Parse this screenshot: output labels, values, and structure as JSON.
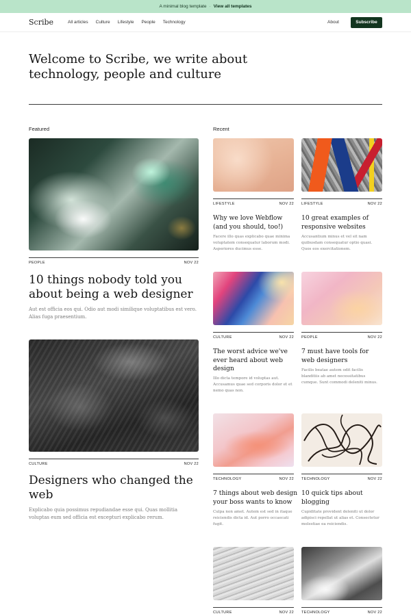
{
  "banner": {
    "text": "A minimal blog template",
    "separator": "·",
    "link": "View all templates"
  },
  "nav": {
    "logo": "Scribe",
    "links": [
      "All articles",
      "Culture",
      "Lifestyle",
      "People",
      "Technology"
    ],
    "about": "About",
    "subscribe": "Subscribe"
  },
  "hero": {
    "title": "Welcome to Scribe, we write about technology, people and culture"
  },
  "featured": {
    "label": "Featured",
    "posts": [
      {
        "category": "PEOPLE",
        "date": "NOV 22",
        "title": "10 things nobody told you about being a web designer",
        "excerpt": "Aut est officia eos qui. Odio aut modi similique voluptatibus est vero. Alias fuga praesentium."
      },
      {
        "category": "CULTURE",
        "date": "NOV 22",
        "title": "Designers who changed the web",
        "excerpt": "Explicabo quia possimus repudiandae esse qui. Quas mollitia voluptas eum sed officia est excepturi explicabo rerum."
      }
    ]
  },
  "recent": {
    "label": "Recent",
    "posts": [
      {
        "category": "LIFESTYLE",
        "date": "NOV 22",
        "title": "Why we love Webflow (and you should, too!)",
        "excerpt": "Facere illo quas explicabo quae minima voluptatem consequatur laborum modi. Asperiores ducimus esse."
      },
      {
        "category": "LIFESTYLE",
        "date": "NOV 22",
        "title": "10 great examples of responsive websites",
        "excerpt": "Accusantium minus et vel sit nam quibusdam consequatur optio quasi. Quos eos exercitationem."
      },
      {
        "category": "CULTURE",
        "date": "NOV 22",
        "title": "The worst advice we've ever heard about web design",
        "excerpt": "Illo dicta tempore id voluptas aut. Accusamus quae sed corporis dolor et et nemo quas non."
      },
      {
        "category": "PEOPLE",
        "date": "NOV 22",
        "title": "7 must have tools for web designers",
        "excerpt": "Facilis beatae autem odit facilis blanditiis ab amet necessitatibus cumque. Sunt commodi deleniti minus."
      },
      {
        "category": "TECHNOLOGY",
        "date": "NOV 22",
        "title": "7 things about web design your boss wants to know",
        "excerpt": "Culpa non amet. Autem est sed in itaque reiciendis dicta id. Aut porro occaecati fugit."
      },
      {
        "category": "TECHNOLOGY",
        "date": "NOV 22",
        "title": "10 quick tips about blogging",
        "excerpt": "Cupiditate provident deleniti ut dolor adipisci repellat ut alias et. Consectetur molestiae ea reiciendis."
      },
      {
        "category": "CULTURE",
        "date": "NOV 22"
      },
      {
        "category": "TECHNOLOGY",
        "date": "NOV 22"
      }
    ]
  },
  "colors": {
    "banner_bg": "#b9e4c9",
    "subscribe_bg": "#13351f"
  },
  "icons": [
    "photo-blur-green",
    "photo-dark-texture",
    "photo-skin",
    "photo-paint-strips",
    "photo-holographic",
    "photo-pastel",
    "photo-coral",
    "photo-line-art",
    "photo-sand-waves",
    "photo-shadow"
  ]
}
